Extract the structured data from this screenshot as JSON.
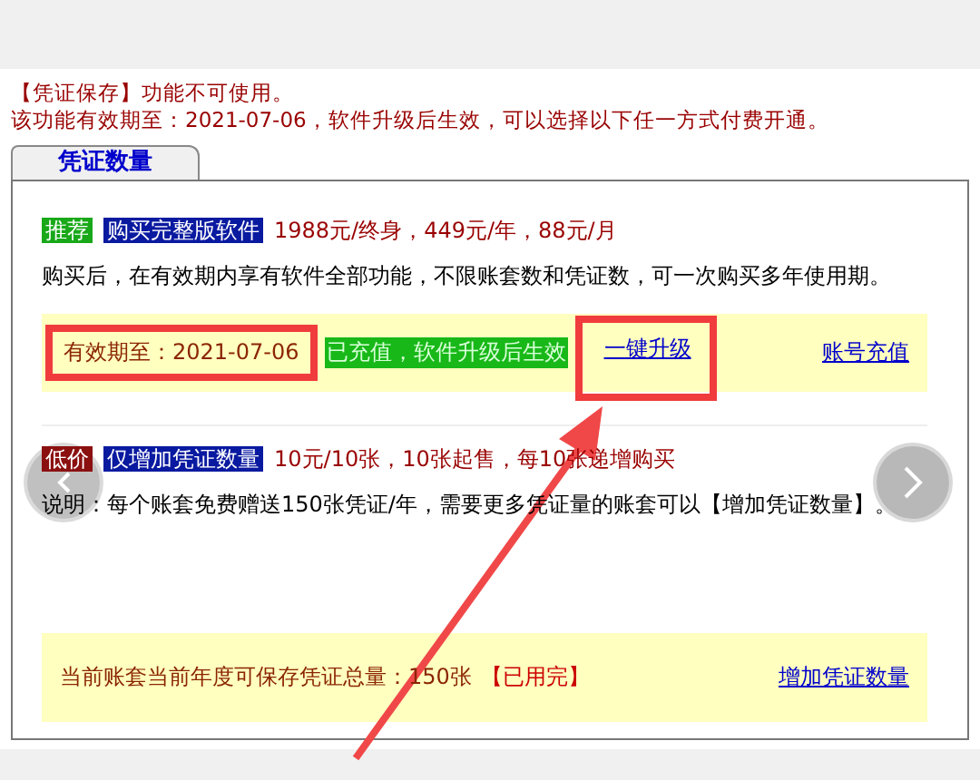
{
  "notice": [
    "【凭证保存】功能不可使用。",
    "该功能有效期至：2021-07-06，软件升级后生效，可以选择以下任一方式付费开通。"
  ],
  "tabs": [
    {
      "label": "凭证数量",
      "selected": true
    }
  ],
  "sections": [
    {
      "badge": {
        "text": "推荐",
        "color": "#18a818"
      },
      "title": "购买完整版软件",
      "price": "1988元/终身，449元/年，88元/月",
      "description": "购买后，在有效期内享有软件全部功能，不限账套数和凭证数，可一次购买多年使用期。",
      "bar": {
        "text": "有效期至：2021-07-06",
        "status": "已充值，软件升级后生效",
        "kind": "highlight",
        "links": [
          "一键升级",
          "账号充值"
        ]
      }
    },
    {
      "badge": {
        "text": "低价",
        "color": "#8b1010"
      },
      "title": "仅增加凭证数量",
      "price": "10元/10张，10张起售，每10张递增购买",
      "description": "说明：每个账套免费赠送150张凭证/年，需要更多凭证量的账套可以【增加凭证数量】。",
      "bar": {
        "text": "当前账套当前年度可保存凭证总量：150张",
        "status": "【已用完】",
        "kind": "plain",
        "links": [
          "增加凭证数量"
        ]
      }
    }
  ]
}
